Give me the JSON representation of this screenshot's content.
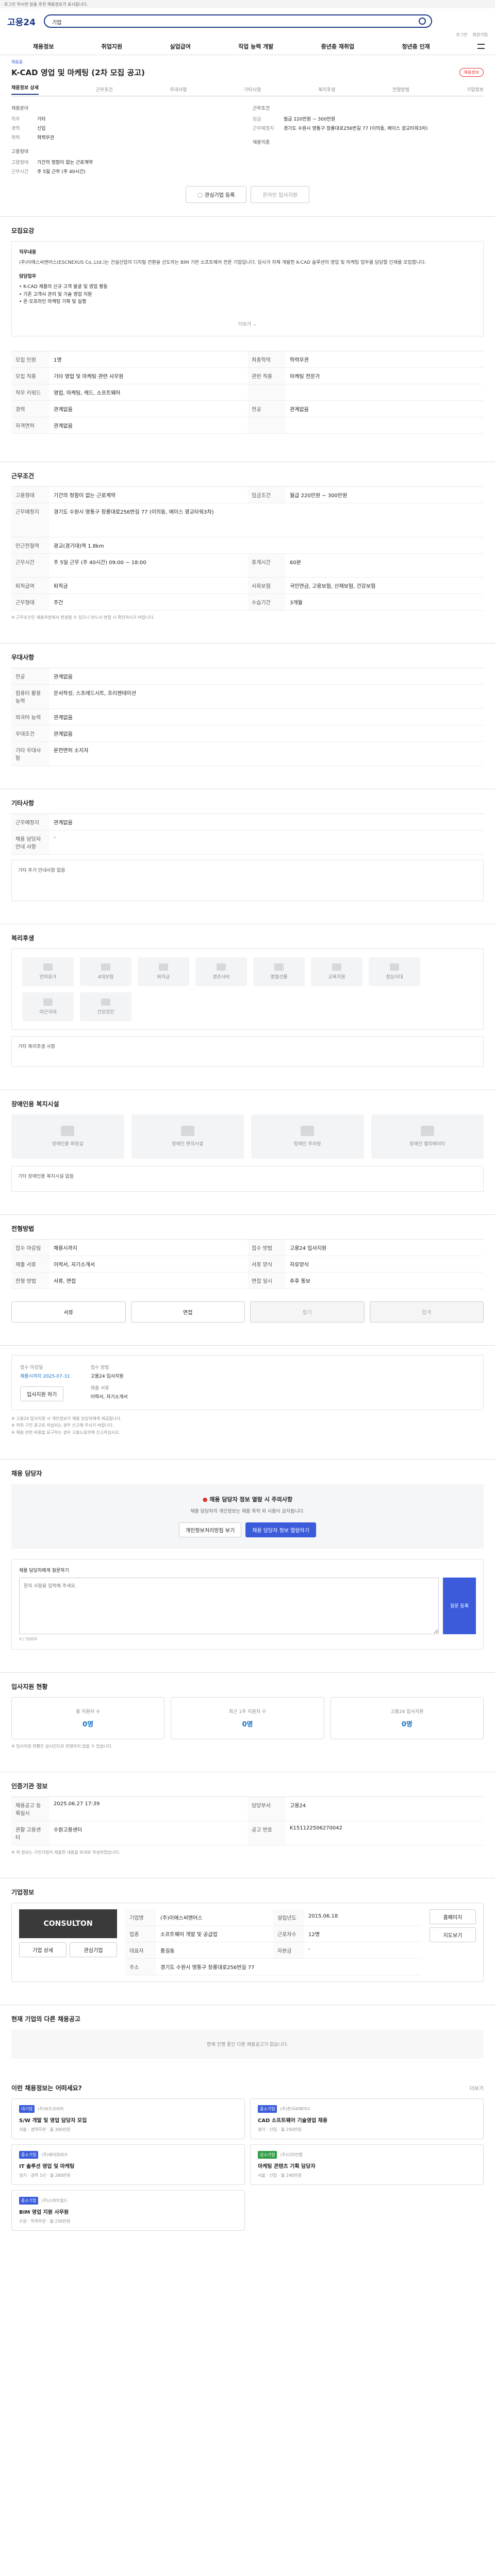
{
  "topbar": {
    "notice": "로그인 하시면 맞춤 추천 채용정보가 표시됩니다."
  },
  "header": {
    "logo": "고용24",
    "search_value": "기업",
    "nav": [
      "채용정보",
      "취업지원",
      "실업급여",
      "직업 능력 개발",
      "중년층 재취업",
      "청년층 인재",
      "더보기"
    ],
    "util": [
      "로그인",
      "회원가입"
    ]
  },
  "tabs": [
    "채용정보 상세",
    "근무조건",
    "우대사항",
    "기타사항",
    "복리후생",
    "전형방법",
    "기업정보"
  ],
  "job": {
    "status": "채용중",
    "title": "K-CAD 영업 및 마케팅 (2차 모집 공고)",
    "badge": "채용정보",
    "left": {
      "label1": "채용분야",
      "rows": [
        [
          "직무",
          "기타"
        ],
        [
          "경력",
          "신입"
        ],
        [
          "학력",
          "학력무관"
        ]
      ],
      "label2": "고용형태",
      "rows2": [
        [
          "고용형태",
          "기간의 정함이 없는 근로계약"
        ],
        [
          "근무시간",
          "주 5일 근무 (주 40시간)"
        ]
      ]
    },
    "right": {
      "label1": "근무조건",
      "rows": [
        [
          "임금",
          "월급 220만원 ~ 300만원"
        ],
        [
          "근무예정지",
          "경기도 수원시 영통구 창룡대로256번길 77 (이의동, 에이스 광교타워3차)"
        ]
      ],
      "label2": "채용직종",
      "rows2": []
    }
  },
  "apply": {
    "button": "온라인 입사지원",
    "interest": "관심기업 등록",
    "scrap": "스크랩"
  },
  "desc": {
    "title": "모집요강",
    "heading": "직무내용",
    "body": "(주)이에스씨앤어스(ESCNEXUS Co.,Ltd.)는 건설산업의 디지털 전환을 선도하는 BIM 기반 소프트웨어 전문 기업입니다. 당사가 자체 개발한 K-CAD 솔루션의 영업 및 마케팅 업무를 담당할 인재를 모집합니다.",
    "sub": "담당업무",
    "items": [
      "K-CAD 제품의 신규 고객 발굴 및 영업 활동",
      "기존 고객사 관리 및 기술 영업 지원",
      "온·오프라인 마케팅 기획 및 실행"
    ],
    "more": "더보기"
  },
  "info": {
    "rows": [
      [
        "모집 인원",
        "1명",
        "최종학력",
        "학력무관"
      ],
      [
        "모집 직종",
        "기타 영업 및 마케팅 관련 사무원",
        "관련 직종",
        "마케팅 전문가"
      ],
      [
        "직무 키워드",
        "영업, 마케팅, 캐드, 소프트웨어",
        "",
        ""
      ],
      [
        "경력",
        "관계없음",
        "전공",
        "관계없음"
      ],
      [
        "자격면허",
        "관계없음",
        "",
        ""
      ]
    ]
  },
  "cond": {
    "title": "근무조건",
    "rows": [
      [
        "고용형태",
        "기간의 정함이 없는 근로계약",
        "임금조건",
        "월급 220만원 ~ 300만원"
      ],
      [
        "근무예정지",
        "경기도 수원시 영통구 창룡대로256번길 77 (이의동, 에이스 광교타워3차)",
        "",
        ""
      ],
      [
        "인근전철역",
        "광교(경기대)역 1.8km",
        "",
        ""
      ],
      [
        "근무시간",
        "주 5일 근무 (주 40시간) 09:00 ~ 18:00",
        "휴게시간",
        "60분"
      ],
      [
        "퇴직급여",
        "퇴직금",
        "사회보험",
        "국민연금, 고용보험, 산재보험, 건강보험"
      ],
      [
        "근무형태",
        "주간",
        "수습기간",
        "3개월"
      ]
    ],
    "note": "※ 근무조건은 채용과정에서 변경될 수 있으니 반드시 면접 시 확인하시기 바랍니다."
  },
  "pref": {
    "title": "우대사항",
    "rows": [
      [
        "전공",
        "관계없음"
      ],
      [
        "컴퓨터 활용 능력",
        "문서작성, 스프레드시트, 프리젠테이션"
      ],
      [
        "외국어 능력",
        "관계없음"
      ],
      [
        "우대조건",
        "관계없음"
      ],
      [
        "기타 우대사항",
        "운전면허 소지자"
      ]
    ]
  },
  "etc": {
    "title": "기타사항",
    "rows": [
      [
        "근무예정지",
        "관계없음"
      ],
      [
        "채용 담당자 안내 사항",
        "-"
      ]
    ],
    "memo": "기타 추가 안내사항 없음"
  },
  "welfare": {
    "title": "복리후생",
    "tiles": [
      "연차휴가",
      "4대보험",
      "퇴직금",
      "경조사비",
      "명절선물",
      "교육지원",
      "점심식대",
      "야근식대",
      "건강검진"
    ],
    "note": "기타 복리후생 사항"
  },
  "disabled": {
    "title": "장애인용 복지시설",
    "tiles": [
      "장애인용 화장실",
      "장애인 편의시설",
      "장애인 주차장",
      "장애인 엘리베이터"
    ],
    "note": "기타 장애인용 복지시설 없음"
  },
  "process": {
    "title": "전형방법",
    "rows": [
      [
        "접수 마감일",
        "채용시까지",
        "접수 방법",
        "고용24 입사지원"
      ],
      [
        "제출 서류",
        "이력서, 자기소개서",
        "서류 양식",
        "자유양식"
      ],
      [
        "전형 방법",
        "서류, 면접",
        "면접 일시",
        "추후 통보"
      ]
    ],
    "steps": [
      "서류",
      "면접",
      "필기",
      "합격"
    ]
  },
  "apply2": {
    "title": "접수 방법",
    "deadline_label": "접수 마감일",
    "deadline": "채용시까지 2025-07-31",
    "method_label": "접수 방법",
    "method": "고용24 입사지원",
    "docs_label": "제출 서류",
    "docs": "이력서, 자기소개서",
    "button": "입사지원 하기",
    "notes": [
      "※ 고용24 입사지원 시 개인정보가 채용 담당자에게 제공됩니다.",
      "※ 허위 구인 광고로 의심되는 경우 신고해 주시기 바랍니다.",
      "※ 채용 관련 비용을 요구하는 경우 고용노동부에 신고하십시오."
    ]
  },
  "contact": {
    "title": "채용 담당자",
    "alert_title": "채용 담당자 정보 열람 시 주의사항",
    "alert_body": "채용 담당자의 개인정보는 채용 목적 외 사용이 금지됩니다.",
    "btn1": "개인정보처리방침 보기",
    "btn2": "채용 담당자 정보 열람하기",
    "q_label": "채용 담당자에게 질문하기",
    "q_placeholder": "문의 사항을 입력해 주세요.",
    "send": "질문 등록",
    "count": "0 / 500자"
  },
  "stats": {
    "title": "입사지원 현황",
    "items": [
      [
        "총 지원자 수",
        "0명"
      ],
      [
        "최근 1주 지원자 수",
        "0명"
      ],
      [
        "고용24 입사지원",
        "0명"
      ]
    ],
    "note": "※ 입사지원 현황은 실시간으로 반영되지 않을 수 있습니다."
  },
  "admin": {
    "title": "인증기관 정보",
    "rows": [
      [
        "채용공고 등록일시",
        "2025.06.27 17:39",
        "담당부서",
        "고용24"
      ],
      [
        "관할 고용센터",
        "수원고용센터",
        "공고 번호",
        "K151122506270042"
      ]
    ],
    "note": "※ 위 정보는 구인기업이 제출한 내용을 토대로 작성되었습니다."
  },
  "company": {
    "title": "기업정보",
    "logo": "CONSULTON",
    "btn1": "기업 상세",
    "btn2": "관심기업",
    "rows": [
      [
        "기업명",
        "(주)이에스씨앤어스",
        "설립년도",
        "2015.06.18"
      ],
      [
        "업종",
        "소프트웨어 개발 및 공급업",
        "근로자수",
        "12명"
      ],
      [
        "대표자",
        "홍길동",
        "자본금",
        "-"
      ],
      [
        "주소",
        "경기도 수원시 영통구 창룡대로256번길 77",
        "",
        ""
      ]
    ],
    "site_btn": "홈페이지",
    "map_btn": "지도보기"
  },
  "others": {
    "title": "현재 기업의 다른 채용공고",
    "empty": "현재 진행 중인 다른 채용공고가 없습니다."
  },
  "reco": {
    "title": "이런 채용정보는 어떠세요?",
    "more": "더보기",
    "cards": [
      {
        "tag": "대기업",
        "co": "(주)비즈코리아",
        "title": "S/W 개발 및 영업 담당자 모집",
        "meta": "서울 · 경력무관 · 월 300만원"
      },
      {
        "tag": "중소기업",
        "co": "(주)한국씨에이디",
        "title": "CAD 소프트웨어 기술영업 채용",
        "meta": "경기 · 신입 · 월 250만원"
      },
      {
        "tag": "중소기업",
        "co": "(주)에이원테크",
        "title": "IT 솔루션 영업 및 마케팅",
        "meta": "경기 · 경력 1년 · 월 280만원"
      },
      {
        "tag": "강소기업",
        "co": "(주)디자인랩",
        "title": "마케팅 콘텐츠 기획 담당자",
        "meta": "서울 · 신입 · 월 240만원"
      },
      {
        "tag": "중소기업",
        "co": "(주)스마트빌드",
        "title": "BIM 영업 지원 사무원",
        "meta": "수원 · 학력무관 · 월 230만원"
      }
    ]
  }
}
